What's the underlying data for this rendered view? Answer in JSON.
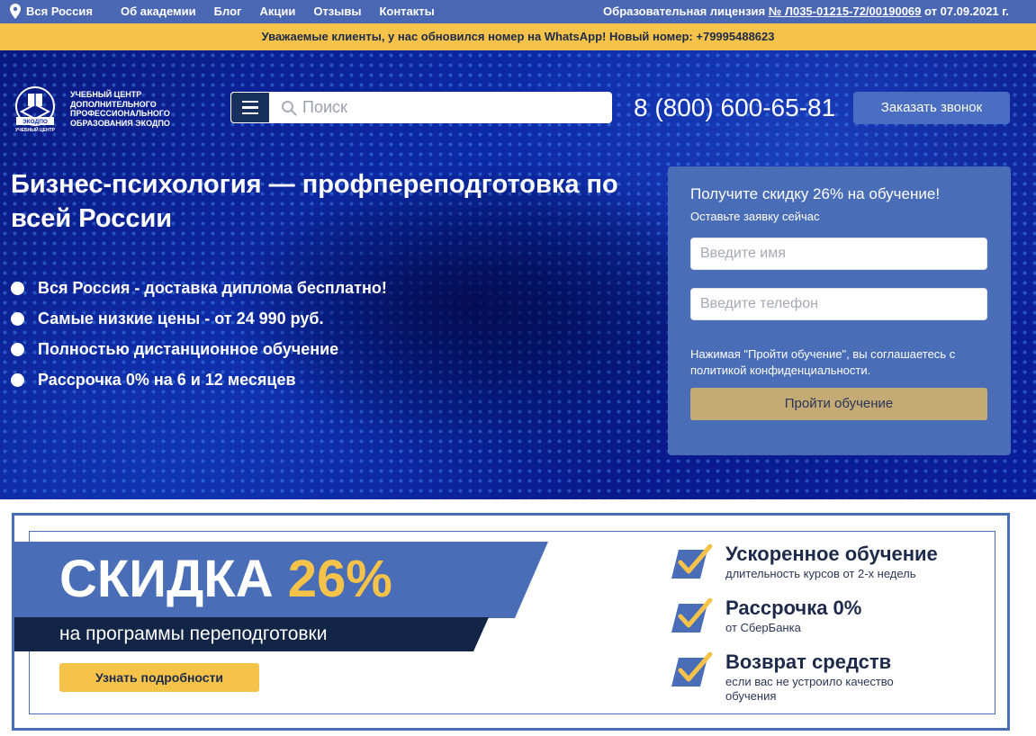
{
  "topbar": {
    "region": "Вся Россия",
    "nav": [
      "Об академии",
      "Блог",
      "Акции",
      "Отзывы",
      "Контакты"
    ],
    "license_prefix": "Образовательная лицензия ",
    "license_number": "№ Л035-01215-72/00190069",
    "license_suffix": " от 07.09.2021 г."
  },
  "notice": "Уважаемые клиенты, у нас обновился номер на WhatsApp! Новый номер: +79995488623",
  "header": {
    "logo_text": "Учебный центр дополнительного профессионального образования ЭКОДПО",
    "logo_badge_top": "ЭКОДПО",
    "logo_badge_bottom": "УЧЕБНЫЙ ЦЕНТР",
    "search_placeholder": "Поиск",
    "phone": "8 (800) 600-65-81",
    "callback_label": "Заказать звонок"
  },
  "hero": {
    "title": "Бизнес-психология — профпереподготовка по всей России",
    "benefits": [
      "Вся Россия - доставка диплома бесплатно!",
      "Самые низкие цены - от 24 990 руб.",
      "Полностью дистанционное обучение",
      "Рассрочка 0% на 6 и 12 месяцев"
    ]
  },
  "form": {
    "title": "Получите скидку 26% на обучение!",
    "subtitle": "Оставьте заявку сейчас",
    "name_placeholder": "Введите имя",
    "phone_placeholder": "Введите телефон",
    "note": "Нажимая \"Пройти обучение\", вы соглашаетесь с политикой конфиденциальности.",
    "submit_label": "Пройти обучение"
  },
  "promo": {
    "discount_word": "СКИДКА",
    "discount_value": "26%",
    "subtitle": "на программы переподготовки",
    "button_label": "Узнать подробности",
    "features": [
      {
        "title": "Ускоренное обучение",
        "subtitle": "длительность курсов от 2-х недель"
      },
      {
        "title": "Рассрочка 0%",
        "subtitle": "от СберБанка"
      },
      {
        "title": "Возврат средств",
        "subtitle": "если вас не устроило качество обучения"
      }
    ]
  },
  "colors": {
    "topbar": "#4a67b3",
    "notice": "#f5c24a",
    "form_bg": "#4a6db7",
    "submit": "#c4aa75",
    "accent_yellow": "#f5c24a",
    "navy": "#17305e"
  },
  "icons": [
    "location-pin-icon",
    "hamburger-menu-icon",
    "search-icon",
    "checkmark-icon"
  ]
}
